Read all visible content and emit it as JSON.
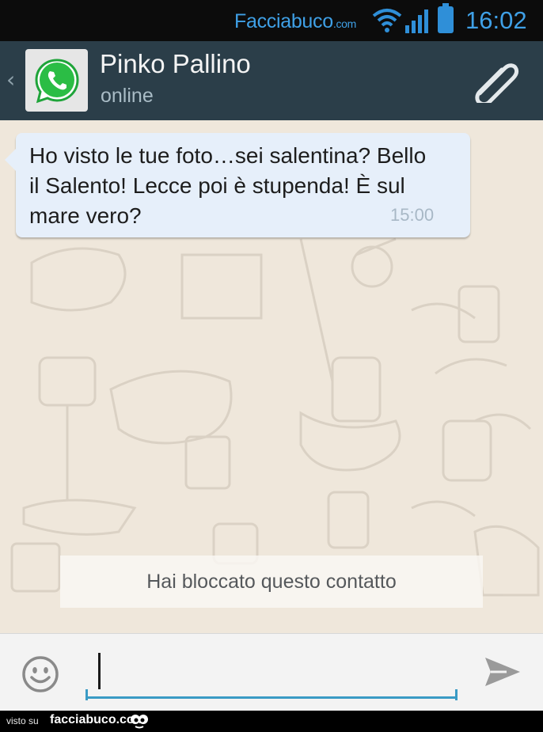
{
  "status_bar": {
    "watermark_main": "Facciabuco",
    "watermark_suffix": ".com",
    "time": "16:02",
    "accent": "#3fa0e6"
  },
  "header": {
    "contact_name": "Pinko Pallino",
    "contact_status": "online",
    "back_icon": "chevron-left-icon",
    "avatar_icon": "whatsapp-logo",
    "attach_icon": "paperclip-icon",
    "bg": "#2b3e49"
  },
  "chat": {
    "messages": [
      {
        "text": "Ho visto le tue foto…sei salentina? Bello il Salento! Lecce poi è stupenda! È sul mare vero?",
        "time": "15:00",
        "direction": "incoming"
      }
    ],
    "system_notice": "Hai bloccato questo contatto",
    "bg": "#efe7db"
  },
  "composer": {
    "value": "",
    "placeholder": "",
    "emoji_icon": "smiley-icon",
    "send_icon": "send-icon",
    "accent": "#3a9bc5"
  },
  "footer": {
    "visto_su": "visto su",
    "site": "facciabuco.com"
  }
}
